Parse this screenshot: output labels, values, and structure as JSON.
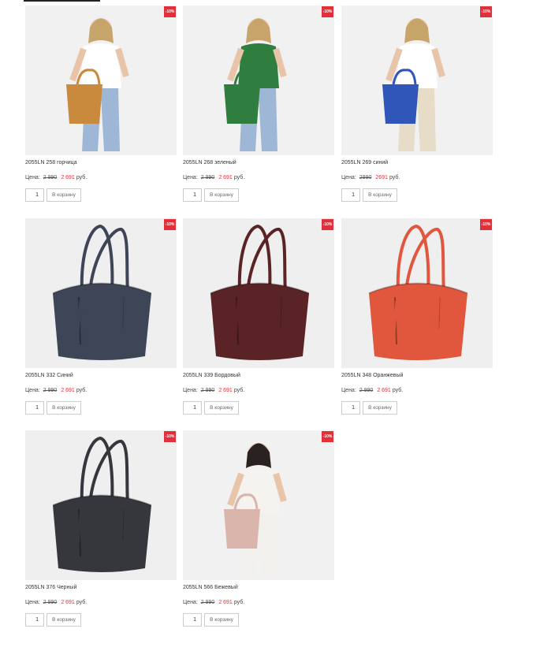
{
  "currency": "руб.",
  "price_label": "Цена:",
  "cart_label": "В корзину",
  "products": [
    {
      "title": "2055LN 258 горчица",
      "old_price": "2 990",
      "new_price": "2 691",
      "discount": "-10%",
      "qty": "1",
      "color": "#c98a3e",
      "kind": "model-tan"
    },
    {
      "title": "2055LN 268 зеленый",
      "old_price": "2 990",
      "new_price": "2 691",
      "discount": "-10%",
      "qty": "1",
      "color": "#2f7d3f",
      "kind": "model-green"
    },
    {
      "title": "2055LN 269 синий",
      "old_price": "2990",
      "new_price": "2691",
      "discount": "-10%",
      "qty": "1",
      "color": "#2f56b8",
      "kind": "model-blue"
    },
    {
      "title": "2055LN 332 Синий",
      "old_price": "2 990",
      "new_price": "2 691",
      "discount": "-10%",
      "qty": "1",
      "color": "#3e4557",
      "kind": "bag"
    },
    {
      "title": "2055LN 339 Бордовый",
      "old_price": "2 990",
      "new_price": "2 691",
      "discount": "-10%",
      "qty": "1",
      "color": "#5a2427",
      "kind": "bag"
    },
    {
      "title": "2055LN 348 Оранжевый",
      "old_price": "2 990",
      "new_price": "2 691",
      "discount": "-10%",
      "qty": "1",
      "color": "#e0573d",
      "kind": "bag"
    },
    {
      "title": "2055LN 376 Черный",
      "old_price": "2 990",
      "new_price": "2 691",
      "discount": "-10%",
      "qty": "1",
      "color": "#36373d",
      "kind": "bag"
    },
    {
      "title": "2055LN 566 Бежевый",
      "old_price": "2 990",
      "new_price": "2 691",
      "discount": "-10%",
      "qty": "1",
      "color": "#d9b5ab",
      "kind": "model-beige"
    }
  ]
}
